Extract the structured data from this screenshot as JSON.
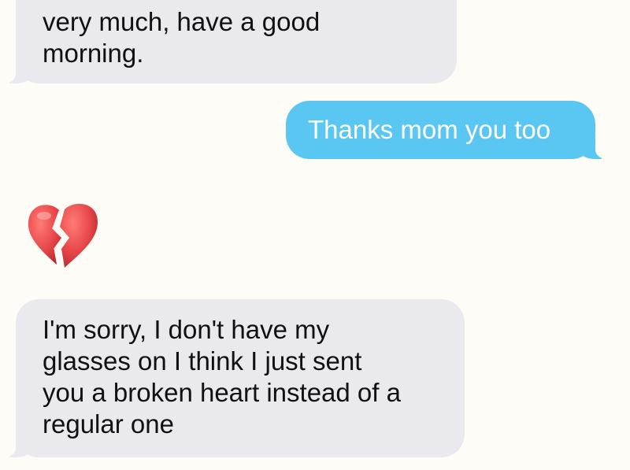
{
  "messages": [
    {
      "direction": "received",
      "lines": [
        "very much, have a good",
        "morning."
      ]
    },
    {
      "direction": "sent",
      "lines": [
        "Thanks mom you too"
      ]
    },
    {
      "direction": "received",
      "emoji": "broken-heart-icon"
    },
    {
      "direction": "received",
      "lines": [
        "I'm sorry, I don't have my",
        "glasses on I think I just sent",
        "you a broken heart instead of a",
        "regular one"
      ]
    }
  ],
  "colors": {
    "background": "#fdfcf7",
    "received_bubble": "#e9e9ee",
    "sent_bubble": "#5ac7f2",
    "heart": "#e8474a"
  }
}
